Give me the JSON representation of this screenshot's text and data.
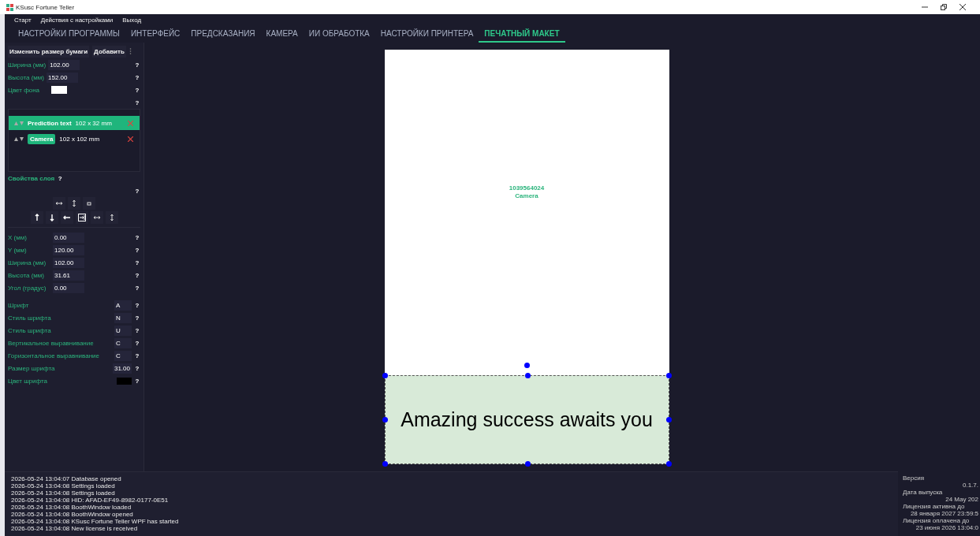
{
  "window": {
    "title": "KSusc Fortune Teller"
  },
  "menu": [
    "Старт",
    "Действия с настройками",
    "Выход"
  ],
  "tabs": [
    {
      "label": "НАСТРОЙКИ ПРОГРАММЫ",
      "selected": false
    },
    {
      "label": "ИНТЕРФЕЙС",
      "selected": false
    },
    {
      "label": "ПРЕДСКАЗАНИЯ",
      "selected": false
    },
    {
      "label": "КАМЕРА",
      "selected": false
    },
    {
      "label": "ИИ ОБРАБОТКА",
      "selected": false
    },
    {
      "label": "НАСТРОЙКИ ПРИНТЕРА",
      "selected": false
    },
    {
      "label": "ПЕЧАТНЫЙ МАКЕТ",
      "selected": true
    }
  ],
  "paper": {
    "buttons": [
      "Изменить размер бумаги",
      "Добавить"
    ],
    "fields": [
      {
        "kind": "input",
        "label": "Ширина (мм)",
        "value": "102.00",
        "help": "?"
      },
      {
        "kind": "input",
        "label": "Высота (мм)",
        "value": "152.00",
        "help": "?"
      },
      {
        "kind": "color",
        "label": "Цвет фона",
        "color": "#ffffff",
        "help": "?"
      }
    ],
    "layers_help": "?"
  },
  "layers": [
    {
      "name": "Prediction text",
      "size": "102 x 32 mm",
      "selected": true
    },
    {
      "name": "Camera",
      "size": "102 x 102 mm",
      "selected": false
    }
  ],
  "layer_props": {
    "title": "Свойства слоя",
    "title_help": "?",
    "tools_help": "?",
    "fields": [
      {
        "kind": "input",
        "label": "X (мм)",
        "value": "0.00",
        "help": "?"
      },
      {
        "kind": "input",
        "label": "Y (мм)",
        "value": "120.00",
        "help": "?"
      },
      {
        "kind": "input",
        "label": "Ширина (мм)",
        "value": "102.00",
        "help": "?"
      },
      {
        "kind": "input",
        "label": "Высота (мм)",
        "value": "31.61",
        "help": "?"
      },
      {
        "kind": "input",
        "label": "Угол (градус)",
        "value": "0.00",
        "help": "?"
      }
    ],
    "font_rows": [
      {
        "kind": "select",
        "label": "Шрифт",
        "value": "A",
        "help": "?"
      },
      {
        "kind": "select",
        "label": "Стиль шрифта",
        "value": "N",
        "help": "?"
      },
      {
        "kind": "select",
        "label": "Стиль шрифта",
        "value": "U",
        "help": "?"
      },
      {
        "kind": "select",
        "label": "Вертикальное выравнивание",
        "value": "C",
        "help": "?"
      },
      {
        "kind": "select",
        "label": "Горизонтальное выравнивание",
        "value": "C",
        "help": "?"
      },
      {
        "kind": "number",
        "label": "Размер шрифта",
        "value": "31.00",
        "help": "?"
      },
      {
        "kind": "color",
        "label": "Цвет шрифта",
        "color": "#000000",
        "help": "?"
      }
    ]
  },
  "canvas": {
    "camera_id": "1039564024",
    "camera_label": "Camera",
    "prediction_text": "Amazing success awaits you"
  },
  "log": [
    "2026-05-24 13:04:07 Database opened",
    "2026-05-24 13:04:08 Settings loaded",
    "2026-05-24 13:04:08 Settings loaded",
    "2026-05-24 13:04:08 HID: AFAD-EF49-8982-0177-0E51",
    "2026-05-24 13:04:08 BoothWindow loaded",
    "2026-05-24 13:04:08 BoothWindow opened",
    "2026-05-24 13:04:08 KSusc Fortune Teller WPF has started",
    "2026-05-24 13:04:08 New license is received"
  ],
  "info": [
    {
      "label": "Версия",
      "value": "0.1.7."
    },
    {
      "label": "Дата выпуска",
      "value": "24 May 202"
    },
    {
      "label": "Лицензия активна до",
      "value": "28 января 2027 23:59:5"
    },
    {
      "label": "Лицензия оплачена до",
      "value": "23 июня 2026 13:04:0"
    }
  ]
}
